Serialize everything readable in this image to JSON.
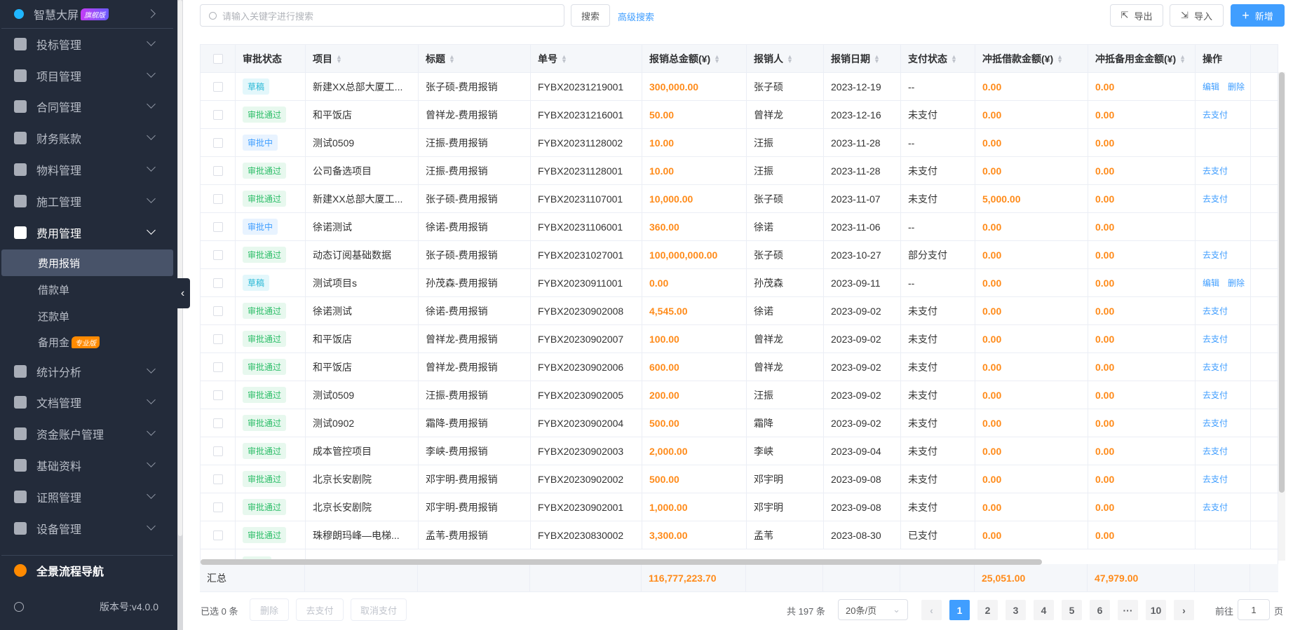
{
  "sidebar": {
    "top": {
      "label": "智慧大屏",
      "badge": "旗舰版"
    },
    "items": [
      {
        "label": "投标管理",
        "icon": "gavel-icon"
      },
      {
        "label": "项目管理",
        "icon": "building-icon"
      },
      {
        "label": "合同管理",
        "icon": "seal-icon"
      },
      {
        "label": "财务账款",
        "icon": "money-bag-icon"
      },
      {
        "label": "物料管理",
        "icon": "warehouse-icon"
      },
      {
        "label": "施工管理",
        "icon": "tools-icon"
      },
      {
        "label": "费用管理",
        "icon": "shield-yen-icon"
      }
    ],
    "sub": [
      {
        "label": "费用报销"
      },
      {
        "label": "借款单"
      },
      {
        "label": "还款单"
      },
      {
        "label": "备用金",
        "badge": "专业版"
      }
    ],
    "items2": [
      {
        "label": "统计分析",
        "icon": "chart-icon"
      },
      {
        "label": "文档管理",
        "icon": "folder-icon"
      },
      {
        "label": "资金账户管理",
        "icon": "card-icon"
      },
      {
        "label": "基础资料",
        "icon": "book-icon"
      },
      {
        "label": "证照管理",
        "icon": "id-card-icon"
      },
      {
        "label": "设备管理",
        "icon": "award-icon"
      }
    ],
    "nav": "全景流程导航",
    "version": "版本号:v4.0.0"
  },
  "toolbar": {
    "search_placeholder": "请输入关键字进行搜索",
    "search": "搜索",
    "advanced": "高级搜索",
    "export": "导出",
    "import": "导入",
    "add": "新增"
  },
  "colors": {
    "accent": "#409eff",
    "amount": "#ff8b1a",
    "sidebar": "#232b3a"
  },
  "table": {
    "headers": [
      "审批状态",
      "项目",
      "标题",
      "单号",
      "报销总金额(¥)",
      "报销人",
      "报销日期",
      "支付状态",
      "冲抵借款金额(¥)",
      "冲抵备用金金额(¥)",
      "操作"
    ],
    "rows": [
      {
        "status": "草稿",
        "tone": "cyan",
        "project": "新建XX总部大厦工...",
        "title": "张子硕-费用报销",
        "no": "FYBX20231219001",
        "total": "300,000.00",
        "person": "张子硕",
        "date": "2023-12-19",
        "pay": "--",
        "loan": "0.00",
        "reserve": "0.00",
        "ops": [
          "编辑",
          "删除"
        ]
      },
      {
        "status": "审批通过",
        "tone": "green",
        "project": "和平饭店",
        "title": "曾祥龙-费用报销",
        "no": "FYBX20231216001",
        "total": "50.00",
        "person": "曾祥龙",
        "date": "2023-12-16",
        "pay": "未支付",
        "loan": "0.00",
        "reserve": "0.00",
        "ops": [
          "去支付"
        ]
      },
      {
        "status": "审批中",
        "tone": "blue",
        "project": "测试0509",
        "title": "汪振-费用报销",
        "no": "FYBX20231128002",
        "total": "10.00",
        "person": "汪振",
        "date": "2023-11-28",
        "pay": "--",
        "loan": "0.00",
        "reserve": "0.00",
        "ops": []
      },
      {
        "status": "审批通过",
        "tone": "green",
        "project": "公司备选项目",
        "title": "汪振-费用报销",
        "no": "FYBX20231128001",
        "total": "10.00",
        "person": "汪振",
        "date": "2023-11-28",
        "pay": "未支付",
        "loan": "0.00",
        "reserve": "0.00",
        "ops": [
          "去支付"
        ]
      },
      {
        "status": "审批通过",
        "tone": "green",
        "project": "新建XX总部大厦工...",
        "title": "张子硕-费用报销",
        "no": "FYBX20231107001",
        "total": "10,000.00",
        "person": "张子硕",
        "date": "2023-11-07",
        "pay": "未支付",
        "loan": "5,000.00",
        "reserve": "0.00",
        "ops": [
          "去支付"
        ]
      },
      {
        "status": "审批中",
        "tone": "blue",
        "project": "徐诺测试",
        "title": "徐诺-费用报销",
        "no": "FYBX20231106001",
        "total": "360.00",
        "person": "徐诺",
        "date": "2023-11-06",
        "pay": "--",
        "loan": "0.00",
        "reserve": "0.00",
        "ops": []
      },
      {
        "status": "审批通过",
        "tone": "green",
        "project": "动态订阅基础数据",
        "title": "张子硕-费用报销",
        "no": "FYBX20231027001",
        "total": "100,000,000.00",
        "person": "张子硕",
        "date": "2023-10-27",
        "pay": "部分支付",
        "loan": "0.00",
        "reserve": "0.00",
        "ops": [
          "去支付"
        ]
      },
      {
        "status": "草稿",
        "tone": "cyan",
        "project": "测试项目s",
        "title": "孙茂森-费用报销",
        "no": "FYBX20230911001",
        "total": "0.00",
        "person": "孙茂森",
        "date": "2023-09-11",
        "pay": "--",
        "loan": "0.00",
        "reserve": "0.00",
        "ops": [
          "编辑",
          "删除"
        ]
      },
      {
        "status": "审批通过",
        "tone": "green",
        "project": "徐诺测试",
        "title": "徐诺-费用报销",
        "no": "FYBX20230902008",
        "total": "4,545.00",
        "person": "徐诺",
        "date": "2023-09-02",
        "pay": "未支付",
        "loan": "0.00",
        "reserve": "0.00",
        "ops": [
          "去支付"
        ]
      },
      {
        "status": "审批通过",
        "tone": "green",
        "project": "和平饭店",
        "title": "曾祥龙-费用报销",
        "no": "FYBX20230902007",
        "total": "100.00",
        "person": "曾祥龙",
        "date": "2023-09-02",
        "pay": "未支付",
        "loan": "0.00",
        "reserve": "0.00",
        "ops": [
          "去支付"
        ]
      },
      {
        "status": "审批通过",
        "tone": "green",
        "project": "和平饭店",
        "title": "曾祥龙-费用报销",
        "no": "FYBX20230902006",
        "total": "600.00",
        "person": "曾祥龙",
        "date": "2023-09-02",
        "pay": "未支付",
        "loan": "0.00",
        "reserve": "0.00",
        "ops": [
          "去支付"
        ]
      },
      {
        "status": "审批通过",
        "tone": "green",
        "project": "测试0509",
        "title": "汪振-费用报销",
        "no": "FYBX20230902005",
        "total": "200.00",
        "person": "汪振",
        "date": "2023-09-02",
        "pay": "未支付",
        "loan": "0.00",
        "reserve": "0.00",
        "ops": [
          "去支付"
        ]
      },
      {
        "status": "审批通过",
        "tone": "green",
        "project": "测试0902",
        "title": "霜降-费用报销",
        "no": "FYBX20230902004",
        "total": "500.00",
        "person": "霜降",
        "date": "2023-09-02",
        "pay": "未支付",
        "loan": "0.00",
        "reserve": "0.00",
        "ops": [
          "去支付"
        ]
      },
      {
        "status": "审批通过",
        "tone": "green",
        "project": "成本管控项目",
        "title": "李峡-费用报销",
        "no": "FYBX20230902003",
        "total": "2,000.00",
        "person": "李峡",
        "date": "2023-09-04",
        "pay": "未支付",
        "loan": "0.00",
        "reserve": "0.00",
        "ops": [
          "去支付"
        ]
      },
      {
        "status": "审批通过",
        "tone": "green",
        "project": "北京长安剧院",
        "title": "邓宇明-费用报销",
        "no": "FYBX20230902002",
        "total": "500.00",
        "person": "邓宇明",
        "date": "2023-09-08",
        "pay": "未支付",
        "loan": "0.00",
        "reserve": "0.00",
        "ops": [
          "去支付"
        ]
      },
      {
        "status": "审批通过",
        "tone": "green",
        "project": "北京长安剧院",
        "title": "邓宇明-费用报销",
        "no": "FYBX20230902001",
        "total": "1,000.00",
        "person": "邓宇明",
        "date": "2023-09-08",
        "pay": "未支付",
        "loan": "0.00",
        "reserve": "0.00",
        "ops": [
          "去支付"
        ]
      },
      {
        "status": "审批通过",
        "tone": "green",
        "project": "珠穆朗玛峰—电梯...",
        "title": "孟苇-费用报销",
        "no": "FYBX20230830002",
        "total": "3,300.00",
        "person": "孟苇",
        "date": "2023-08-30",
        "pay": "已支付",
        "loan": "0.00",
        "reserve": "0.00",
        "ops": []
      }
    ],
    "summary": {
      "label": "汇总",
      "total": "116,777,223.70",
      "loan": "25,051.00",
      "reserve": "47,979.00"
    }
  },
  "footer": {
    "selected": "已选 0 条",
    "delete": "删除",
    "pay": "去支付",
    "cancel_pay": "取消支付",
    "total": "共 197 条",
    "page_size": "20条/页",
    "pages": [
      "1",
      "2",
      "3",
      "4",
      "5",
      "6",
      "···",
      "10"
    ],
    "current_page": 1,
    "goto": "前往",
    "goto_value": "1",
    "page_unit": "页"
  }
}
